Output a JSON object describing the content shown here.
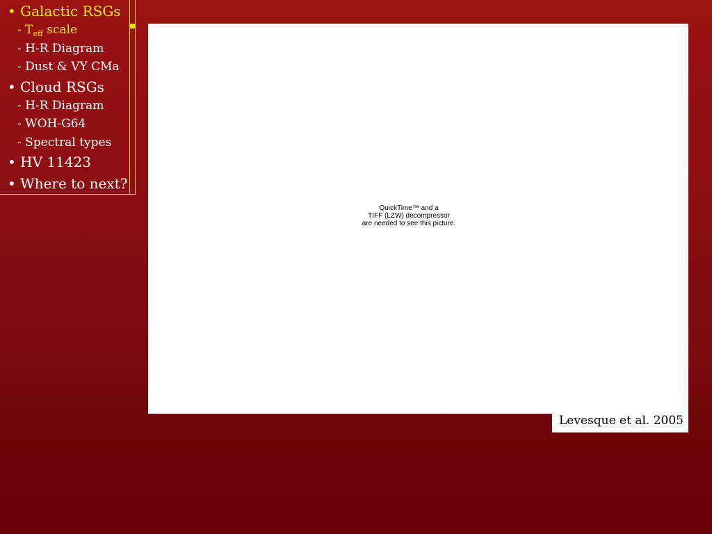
{
  "outline": {
    "items": [
      {
        "text": "• Galactic RSGs",
        "level": "main",
        "active": true
      },
      {
        "prefix": "- T",
        "sub": "eff",
        "suffix": " scale",
        "level": "sub",
        "active": true
      },
      {
        "text": "- H-R Diagram",
        "level": "sub",
        "active": false
      },
      {
        "text": "- Dust & VY CMa",
        "level": "sub",
        "active": false
      },
      {
        "text": "• Cloud RSGs",
        "level": "main",
        "active": false
      },
      {
        "text": "- H-R Diagram",
        "level": "sub",
        "active": false
      },
      {
        "text": "- WOH-G64",
        "level": "sub",
        "active": false
      },
      {
        "text": "- Spectral types",
        "level": "sub",
        "active": false
      },
      {
        "text": "• HV 11423",
        "level": "main",
        "active": false
      },
      {
        "text": "• Where to next?",
        "level": "main",
        "active": false
      }
    ],
    "active_color": "#f5e51a",
    "text_color": "#ffffff",
    "border_color": "#e8c93a"
  },
  "figure": {
    "placeholder_lines": [
      "QuickTime™ and a",
      "TIFF (LZW) decompressor",
      "are needed to see this picture."
    ]
  },
  "caption": {
    "text": "Levesque et al. 2005"
  },
  "theme": {
    "background_top": "#9a1214",
    "background_bottom": "#660208"
  }
}
